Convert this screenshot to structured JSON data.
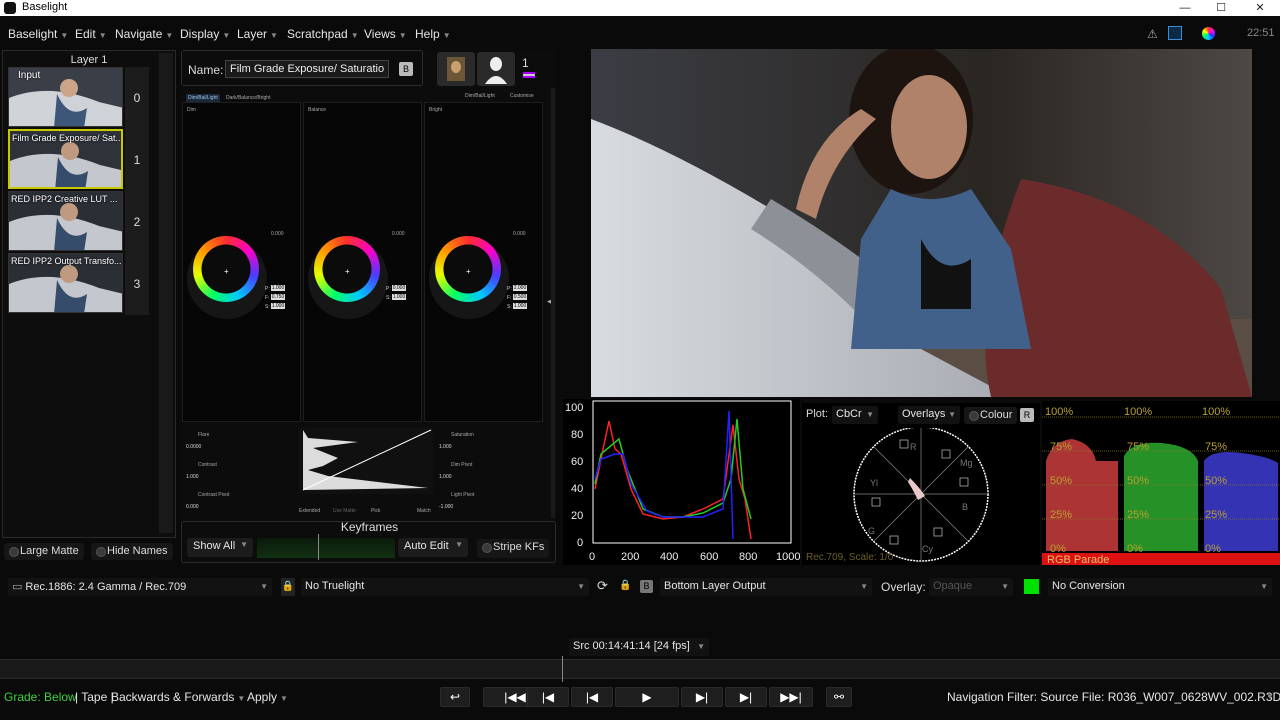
{
  "window": {
    "title": "Baselight",
    "minimize": "—",
    "maximize": "☐",
    "close": "✕"
  },
  "menu": [
    {
      "label": "Baselight"
    },
    {
      "label": "Edit"
    },
    {
      "label": "Navigate"
    },
    {
      "label": "Display"
    },
    {
      "label": "Layer"
    },
    {
      "label": "Scratchpad"
    },
    {
      "label": "Views"
    },
    {
      "label": "Help"
    }
  ],
  "clock": "22:51",
  "layers": {
    "title": "Layer 1",
    "items": [
      {
        "label": "Input",
        "num": "0",
        "selected": false
      },
      {
        "label": "Film Grade Exposure/ Sat...",
        "num": "1",
        "selected": true
      },
      {
        "label": "RED IPP2 Creative LUT ...",
        "num": "2",
        "selected": false
      },
      {
        "label": "RED IPP2 Output Transfo...",
        "num": "3",
        "selected": false
      }
    ],
    "large_matte": "Large Matte",
    "hide_names": "Hide Names"
  },
  "grade": {
    "name_label": "Name:",
    "name_value": "Film Grade Exposure/ Saturatio",
    "b_badge": "B",
    "layer_count": "1",
    "tabs": {
      "left_a": "Dim/Bal/Light",
      "left_b": "Dark/Balance/Bright",
      "right_a": "Dim/Bal/Light",
      "right_b": "Customise"
    },
    "columns": [
      {
        "name": "Dim",
        "value": "0.000",
        "fields": [
          {
            "k": "P:",
            "v": "1.000"
          },
          {
            "k": "F:",
            "v": "0.750"
          },
          {
            "k": "S:",
            "v": "1.000"
          }
        ]
      },
      {
        "name": "Balance",
        "value": "0.000",
        "fields": [
          {
            "k": "P:",
            "v": "0.000"
          },
          {
            "k": "S:",
            "v": "1.000"
          }
        ]
      },
      {
        "name": "Bright",
        "value": "0.000",
        "fields": [
          {
            "k": "P:",
            "v": "2.000"
          },
          {
            "k": "F:",
            "v": "0.500"
          },
          {
            "k": "S:",
            "v": "1.000"
          }
        ]
      }
    ],
    "left_controls": [
      {
        "name": "Flare",
        "value": "0.0000"
      },
      {
        "name": "Contrast",
        "value": "1.000"
      },
      {
        "name": "Contrast Pivot",
        "value": "0.000"
      }
    ],
    "right_controls": [
      {
        "name": "Saturation",
        "value": "1.000"
      },
      {
        "name": "Dim Pivot",
        "value": "1.000"
      },
      {
        "name": "Light Pivot",
        "value": "-1.000"
      }
    ],
    "graph_buttons": {
      "extended": "Extended",
      "use_matte": "Use Matte",
      "pick": "Pick",
      "match": "Match"
    },
    "keyframes_title": "Keyframes",
    "show_all": "Show All",
    "auto_edit": "Auto Edit",
    "stripe_kfs": "Stripe KFs"
  },
  "scopes": {
    "waveform": {
      "y_ticks": [
        "100",
        "80",
        "60",
        "40",
        "20",
        "0"
      ],
      "x_ticks": [
        "0",
        "200",
        "400",
        "600",
        "800",
        "1000"
      ]
    },
    "vectorscope": {
      "plot_label": "Plot:",
      "plot_value": "CbCr",
      "overlays": "Overlays",
      "colour": "Colour",
      "r_badge": "R",
      "footer": "Rec.709, Scale: 1/0",
      "targets": [
        "R",
        "Mg",
        "B",
        "Cy",
        "G",
        "Yl"
      ]
    },
    "parade": {
      "labels": [
        "100%",
        "75%",
        "50%",
        "25%",
        "0%"
      ],
      "footer": "RGB Parade"
    }
  },
  "display": {
    "colour_space": "Rec.1886: 2.4 Gamma / Rec.709",
    "truelight": "No Truelight",
    "b_badge": "B",
    "bottom_output": "Bottom Layer Output",
    "overlay_label": "Overlay:",
    "overlay_value": "Opaque",
    "conversion": "No Conversion",
    "accent_green": "#00e000"
  },
  "timecode": "Src 00:14:41:14 [24 fps]",
  "transport": {
    "grade_label": "Grade:",
    "grade_value": "Below",
    "tape": "Tape",
    "direction": "Backwards & Forwards",
    "apply": "Apply",
    "nav_filter": "Navigation Filter: Source File: R036_W007_0628WV_002.R3D"
  }
}
